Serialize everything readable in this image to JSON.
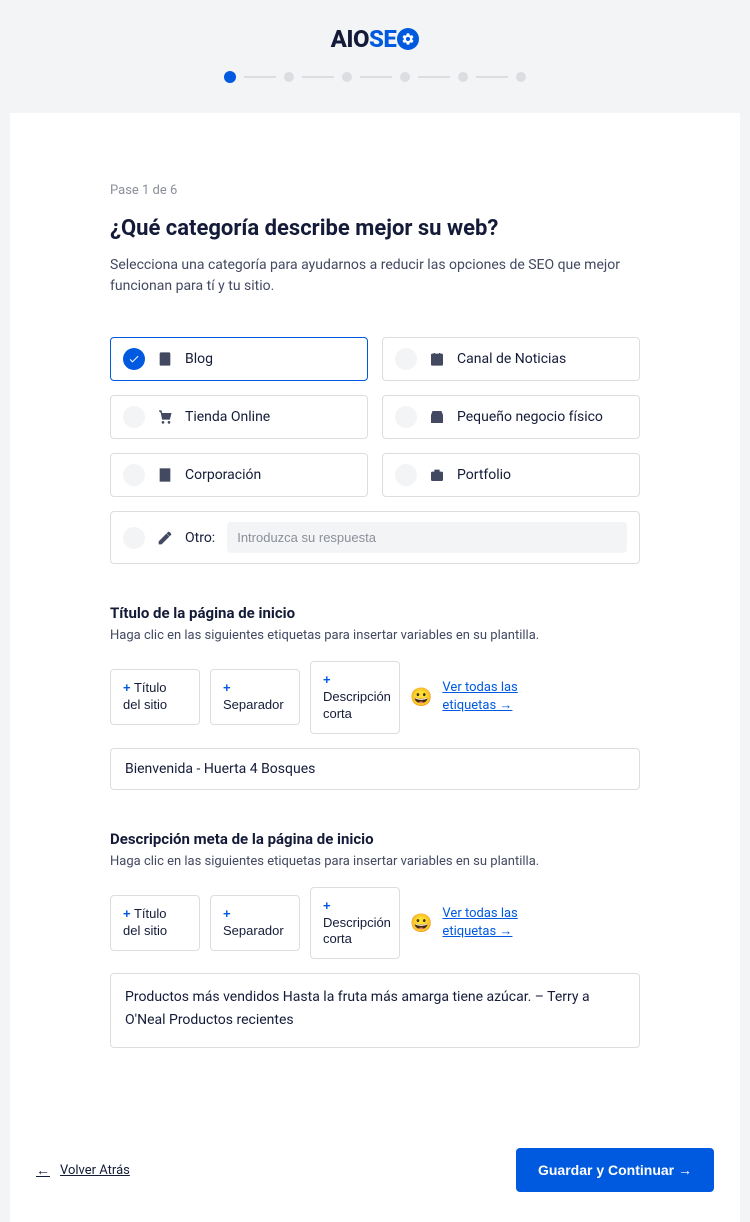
{
  "logo": {
    "part1": "AIO",
    "part2": "SE"
  },
  "step_text": "Pase 1 de 6",
  "title": "¿Qué categoría describe mejor su web?",
  "subtitle": "Selecciona una categoría para ayudarnos a reducir las opciones de SEO que mejor funcionan para tí y tu sitio.",
  "categories": {
    "blog": "Blog",
    "news": "Canal de Noticias",
    "store": "Tienda Online",
    "local": "Pequeño negocio físico",
    "corp": "Corporación",
    "portfolio": "Portfolio",
    "other_label": "Otro:",
    "other_placeholder": "Introduzca su respuesta"
  },
  "home_title": {
    "heading": "Título de la página de inicio",
    "hint": "Haga clic en las siguientes etiquetas para insertar variables en su plantilla.",
    "value": "Bienvenida - Huerta 4 Bosques"
  },
  "meta_desc": {
    "heading": "Descripción meta de la página de inicio",
    "hint": "Haga clic en las siguientes etiquetas para insertar variables en su plantilla.",
    "value": "Productos más vendidos Hasta la fruta más amarga tiene azúcar. – Terry a O'Neal Productos recientes"
  },
  "tags": {
    "site_title": "Título del sitio",
    "separator": "Separador",
    "short_desc": "Descripción corta",
    "see_all": "Ver todas las etiquetas →"
  },
  "footer": {
    "back": "Volver Atrás",
    "continue": "Guardar y Continuar →"
  }
}
